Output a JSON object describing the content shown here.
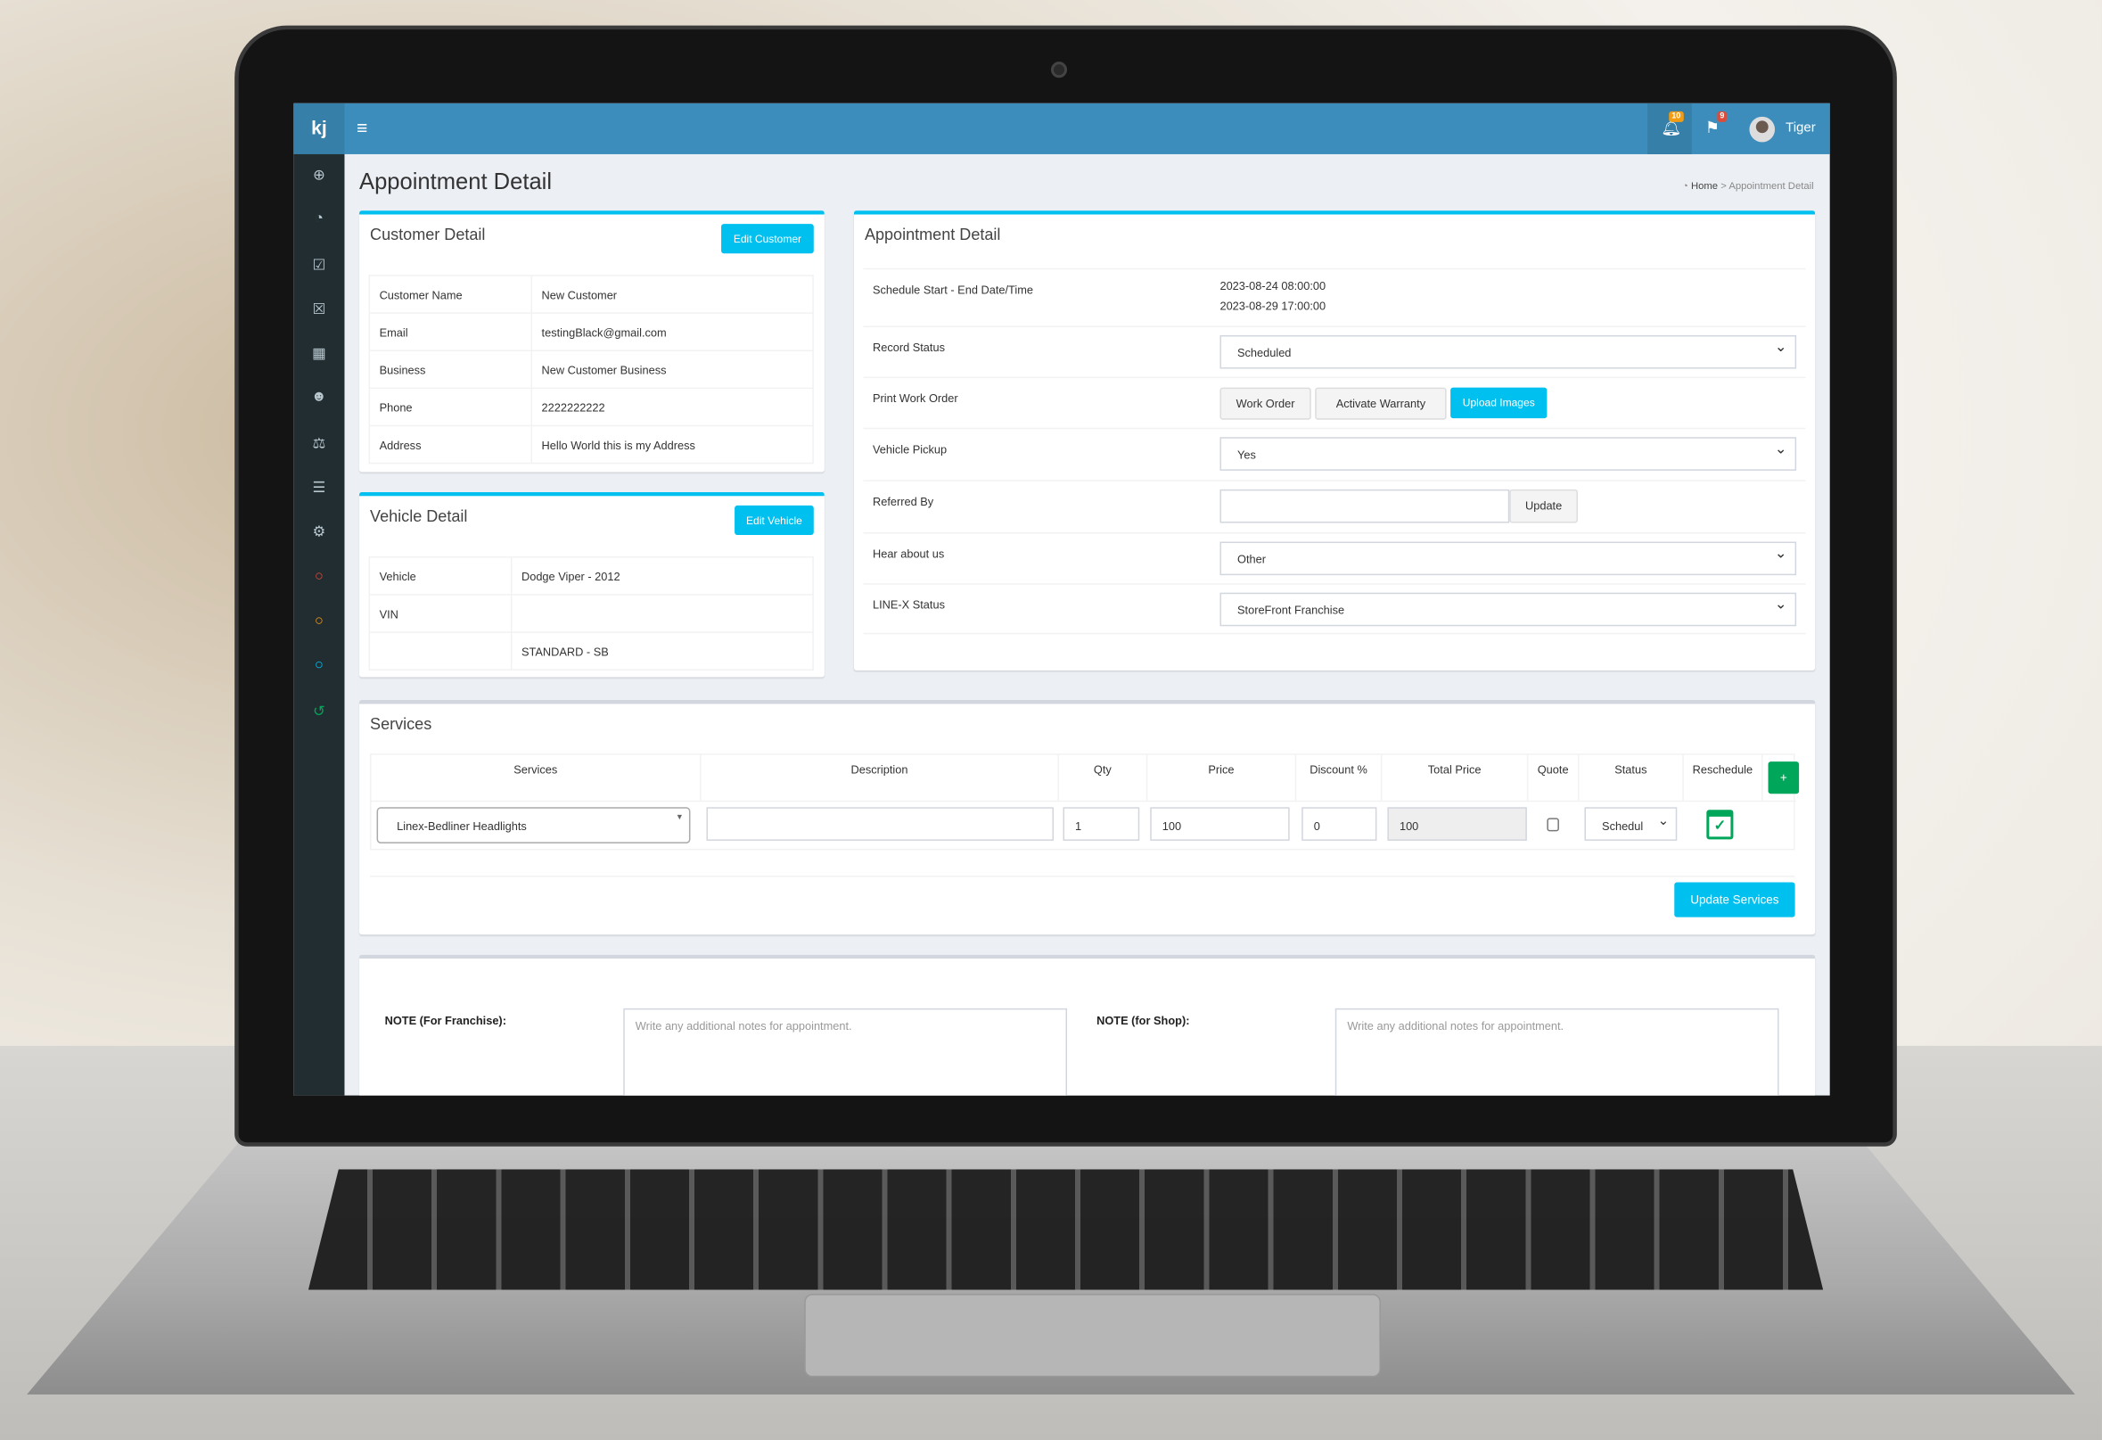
{
  "app": {
    "logo": "kj",
    "user": "Tiger",
    "notifications_count": "10",
    "flags_count": "9",
    "accent": "#3c8dbc",
    "info": "#00c0ef",
    "success": "#00a65a"
  },
  "sidebar": {
    "icons": [
      "search-plus-icon",
      "dashboard-icon",
      "calendar-check-icon",
      "calendar-times-icon",
      "calendar-icon",
      "users-icon",
      "balance-scale-icon",
      "list-icon",
      "cogs-icon",
      "circle-red-icon",
      "circle-orange-icon",
      "circle-blue-icon",
      "history-icon"
    ]
  },
  "page": {
    "title": "Appointment Detail",
    "breadcrumb": [
      "Home",
      "Appointment Detail"
    ]
  },
  "customer": {
    "title": "Customer Detail",
    "edit_label": "Edit Customer",
    "rows": [
      {
        "label": "Customer Name",
        "value": "New Customer"
      },
      {
        "label": "Email",
        "value": "testingBlack@gmail.com"
      },
      {
        "label": "Business",
        "value": "New Customer Business"
      },
      {
        "label": "Phone",
        "value": "2222222222"
      },
      {
        "label": "Address",
        "value": "Hello World this is my Address"
      }
    ]
  },
  "vehicle": {
    "title": "Vehicle Detail",
    "edit_label": "Edit Vehicle",
    "rows": [
      {
        "label": "Vehicle",
        "value": "Dodge Viper - 2012"
      },
      {
        "label": "VIN",
        "value": ""
      },
      {
        "label": "",
        "value": "STANDARD - SB"
      }
    ]
  },
  "appointment": {
    "title": "Appointment Detail",
    "schedule_label": "Schedule Start - End Date/Time",
    "schedule_start": "2023-08-24 08:00:00",
    "schedule_end": "2023-08-29 17:00:00",
    "record_status_label": "Record Status",
    "record_status": "Scheduled",
    "print_label": "Print Work Order",
    "work_order": "Work Order",
    "activate_warranty": "Activate Warranty",
    "upload_images": "Upload Images",
    "pickup_label": "Vehicle Pickup",
    "pickup": "Yes",
    "referred_label": "Referred By",
    "referred_value": "",
    "update": "Update",
    "hear_label": "Hear about us",
    "hear": "Other",
    "linex_label": "LINE-X Status",
    "linex": "StoreFront Franchise"
  },
  "services": {
    "title": "Services",
    "headers": [
      "Services",
      "Description",
      "Qty",
      "Price",
      "Discount %",
      "Total Price",
      "Quote",
      "Status",
      "Reschedule"
    ],
    "add_label": "+",
    "row": {
      "service": "Linex-Bedliner Headlights",
      "description": "",
      "qty": "1",
      "price": "100",
      "discount": "0",
      "total": "100",
      "quote": false,
      "status": "Schedul"
    },
    "update_label": "Update Services"
  },
  "notes": {
    "franchise_label": "NOTE (For Franchise):",
    "shop_label": "NOTE (for Shop):",
    "placeholder": "Write any additional notes for appointment."
  }
}
